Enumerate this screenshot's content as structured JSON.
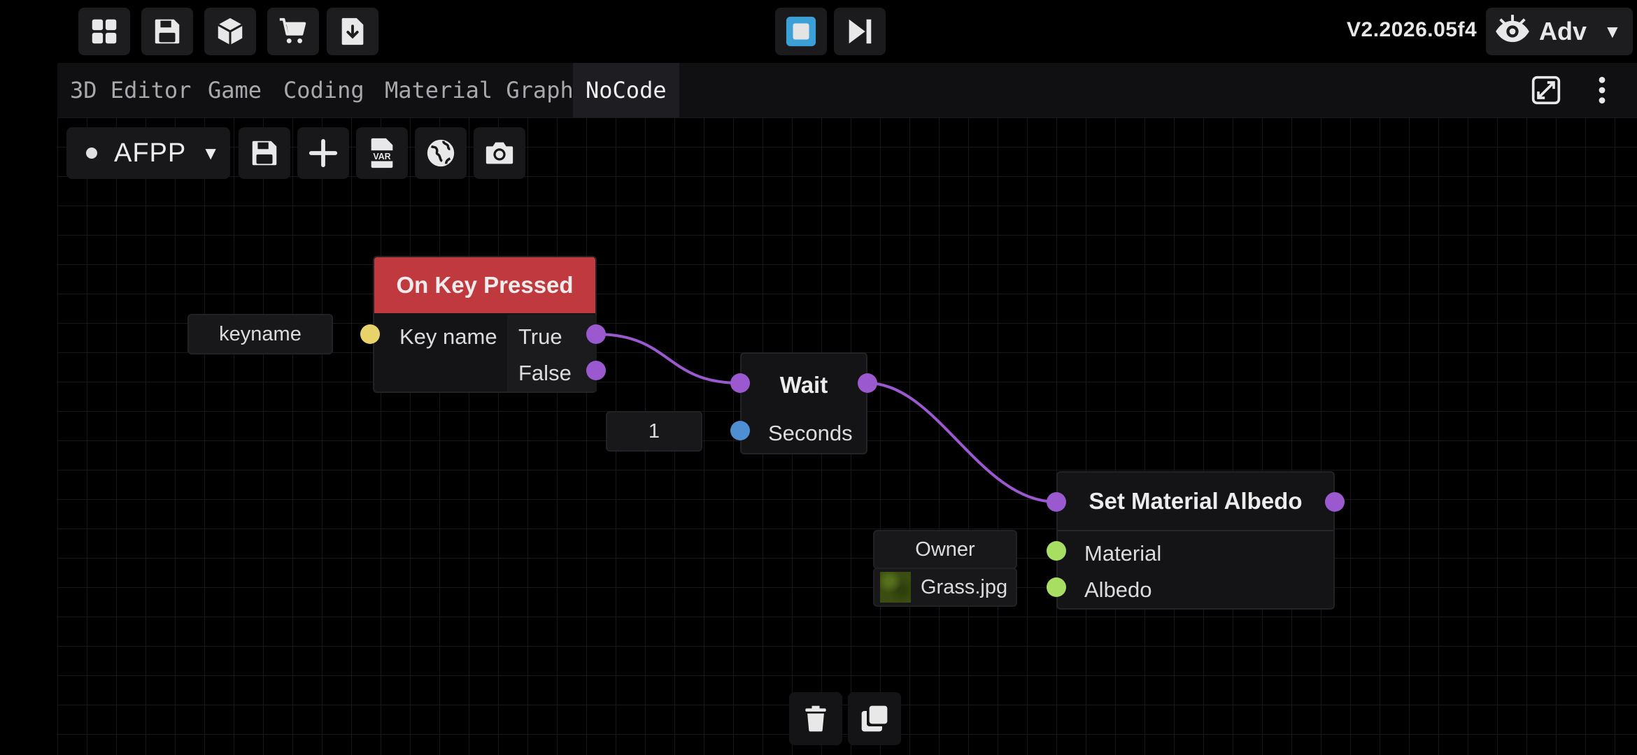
{
  "toolbar": {
    "icons": [
      "grid-icon",
      "save-icon",
      "cube-icon",
      "cart-icon",
      "import-file-icon"
    ],
    "play_controls": [
      "stop-icon",
      "step-forward-icon"
    ],
    "version": "V2.2026.05f4",
    "mode_label": "Adv",
    "mode_icon": "eye-icon"
  },
  "tabs": [
    {
      "label": "3D Editor"
    },
    {
      "label": "Game"
    },
    {
      "label": "Coding"
    },
    {
      "label": "Material Graph"
    },
    {
      "label": "NoCode"
    }
  ],
  "active_tab": "NoCode",
  "graph_toolbar": {
    "graph_name": "AFPP",
    "buttons": [
      "save-icon",
      "plus-icon",
      "var-file-icon",
      "globe-icon",
      "camera-icon"
    ]
  },
  "nodes": {
    "on_key_pressed": {
      "title": "On Key Pressed",
      "input_label": "Key name",
      "input_value": "keyname",
      "output_true": "True",
      "output_false": "False",
      "header_color": "#c0393f"
    },
    "wait": {
      "title": "Wait",
      "input_label": "Seconds",
      "input_value": "1"
    },
    "set_material_albedo": {
      "title": "Set Material Albedo",
      "input_material_label": "Material",
      "input_material_value": "Owner",
      "input_albedo_label": "Albedo",
      "input_albedo_value": "Grass.jpg"
    }
  },
  "colors": {
    "accent_stop": "#3aa0d6",
    "wire": "#9b59d0",
    "port_yellow": "#e8d36a",
    "port_blue": "#4d8fd1",
    "port_green": "#a8de62"
  },
  "bottom_actions": [
    "trash-icon",
    "copy-icon"
  ]
}
